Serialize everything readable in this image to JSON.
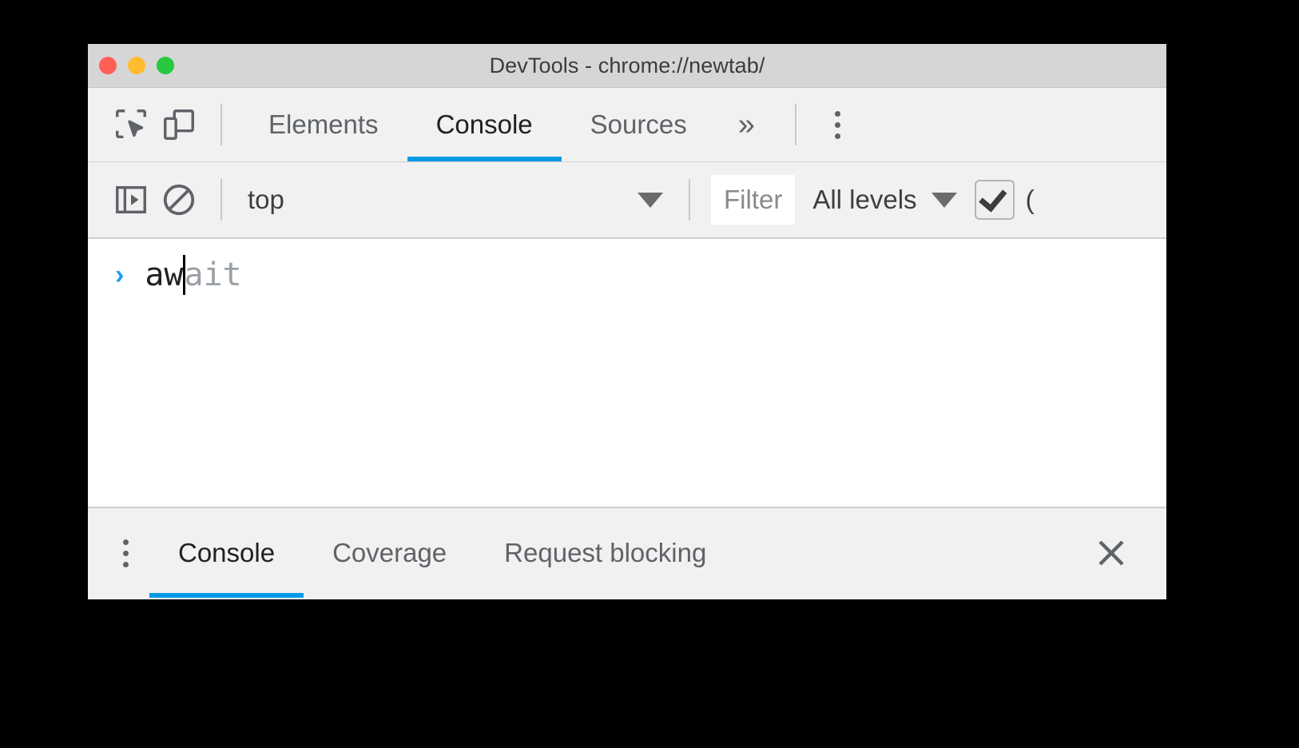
{
  "window": {
    "title": "DevTools - chrome://newtab/",
    "traffic_lights": [
      {
        "name": "close",
        "color": "#ff5f56"
      },
      {
        "name": "minimize",
        "color": "#febc2e"
      },
      {
        "name": "zoom",
        "color": "#28c840"
      }
    ]
  },
  "toolbar": {
    "inspect_icon": "inspect-element-icon",
    "device_icon": "device-toolbar-icon",
    "overflow_label": "»",
    "more_menu": "more-options-icon",
    "tabs": [
      {
        "label": "Elements",
        "active": false
      },
      {
        "label": "Console",
        "active": true
      },
      {
        "label": "Sources",
        "active": false
      }
    ]
  },
  "console_toolbar": {
    "sidebar_toggle_icon": "console-sidebar-icon",
    "clear_console_icon": "clear-console-icon",
    "context_value": "top",
    "filter_placeholder": "Filter",
    "levels_value": "All levels",
    "checkbox_checked": true,
    "trailing_label": "("
  },
  "console": {
    "prompt_symbol": "›",
    "typed_text": "aw",
    "ghost_text": "ait"
  },
  "drawer": {
    "more_menu": "drawer-more-options-icon",
    "tabs": [
      {
        "label": "Console",
        "active": true
      },
      {
        "label": "Coverage",
        "active": false
      },
      {
        "label": "Request blocking",
        "active": false
      }
    ],
    "close_label": "close-drawer-icon"
  },
  "colors": {
    "accent_blue": "#039be5",
    "prompt_blue": "#1a9ff0",
    "toolbar_bg": "#f1f1f1",
    "titlebar_bg": "#d6d6d6",
    "ghost_gray": "#9aa0a6"
  }
}
